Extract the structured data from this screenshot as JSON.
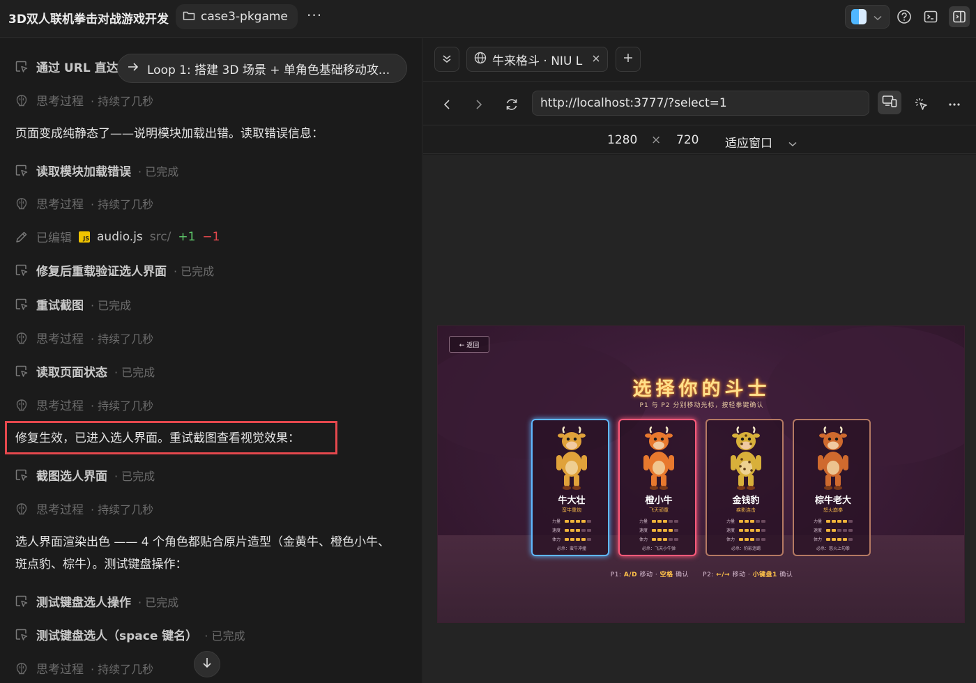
{
  "app": {
    "title": "3D双人联机拳击对战游戏开发",
    "folder": "case3-pkgame",
    "more": "···"
  },
  "chat": {
    "loop_pill": "Loop 1: 搭建 3D 场景 + 单角色基础移动攻...",
    "rows": [
      {
        "label": "通过 URL 直达",
        "meta": ""
      },
      {
        "label": "思考过程",
        "meta": "· 持续了几秒"
      },
      {
        "label": "读取模块加载错误",
        "meta": "· 已完成"
      },
      {
        "label": "思考过程",
        "meta": "· 持续了几秒"
      },
      {
        "label": "修复后重载验证选人界面",
        "meta": "· 已完成"
      },
      {
        "label": "重试截图",
        "meta": "· 已完成"
      },
      {
        "label": "思考过程",
        "meta": "· 持续了几秒"
      },
      {
        "label": "读取页面状态",
        "meta": "· 已完成"
      },
      {
        "label": "思考过程",
        "meta": "· 持续了几秒"
      },
      {
        "label": "截图选人界面",
        "meta": "· 已完成"
      },
      {
        "label": "思考过程",
        "meta": "· 持续了几秒"
      },
      {
        "label": "测试键盘选人操作",
        "meta": "· 已完成"
      },
      {
        "label": "测试键盘选人（space 键名）",
        "meta": "· 已完成"
      },
      {
        "label": "思考过程",
        "meta": "· 持续了几秒"
      }
    ],
    "edit_row": {
      "label": "已编辑",
      "file": "audio.js",
      "path": "src/",
      "plus": "+1",
      "minus": "−1",
      "badge": "JS"
    },
    "para1": "页面变成纯静态了——说明模块加载出错。读取错误信息：",
    "para2": "修复生效，已进入选人界面。重试截图查看视觉效果：",
    "para3": "选人界面渲染出色 —— 4 个角色都贴合原片造型（金黄牛、橙色小牛、斑点豹、棕牛）。测试键盘操作："
  },
  "browser": {
    "tab_title": "牛来格斗 · NIU L",
    "url": "http://localhost:3777/?select=1",
    "width": "1280",
    "times": "×",
    "height": "720",
    "fit_label": "适应窗口"
  },
  "game": {
    "back_label": "← 返回",
    "title": "选择你的斗士",
    "subtitle": "P1 与 P2 分别移动光标，按轻拳键确认",
    "stat_labels": {
      "power": "力量",
      "speed": "速度",
      "stamina": "体力"
    },
    "fighters": [
      {
        "name": "牛大壮",
        "title": "蛮牛重炮",
        "skill": "必杀：蛮牛冲撞",
        "power": 0.8,
        "speed": 0.6,
        "stamina": 0.8,
        "border": "#5fb8ff",
        "body": "#e0a23a",
        "spots": false
      },
      {
        "name": "橙小牛",
        "title": "飞天顽童",
        "skill": "必杀：飞天小牛弹",
        "power": 0.6,
        "speed": 0.8,
        "stamina": 0.6,
        "border": "#ff5a7a",
        "body": "#e8792e",
        "spots": false
      },
      {
        "name": "金钱豹",
        "title": "疾影连击",
        "skill": "必杀：豹影连踢",
        "power": 0.6,
        "speed": 0.8,
        "stamina": 0.6,
        "border": "#b57a63",
        "body": "#d8b03a",
        "spots": true
      },
      {
        "name": "棕牛老大",
        "title": "怒火崩拳",
        "skill": "必杀：怒火上勾拳",
        "power": 0.8,
        "speed": 0.4,
        "stamina": 0.8,
        "border": "#b57a63",
        "body": "#cf6a2e",
        "spots": false
      }
    ],
    "controls": {
      "p1_prefix": "P1:",
      "p1_keys": "A/D",
      "p1_move": "移动 ·",
      "p1_confirm_key": "空格",
      "p1_confirm": "确认",
      "p2_prefix": "P2:",
      "p2_keys": "←/→",
      "p2_move": "移动 ·",
      "p2_confirm_key": "小键盘1",
      "p2_confirm": "确认"
    }
  },
  "colors": {
    "highlight": "#e5484d",
    "accent_gold": "#ffc24a"
  }
}
